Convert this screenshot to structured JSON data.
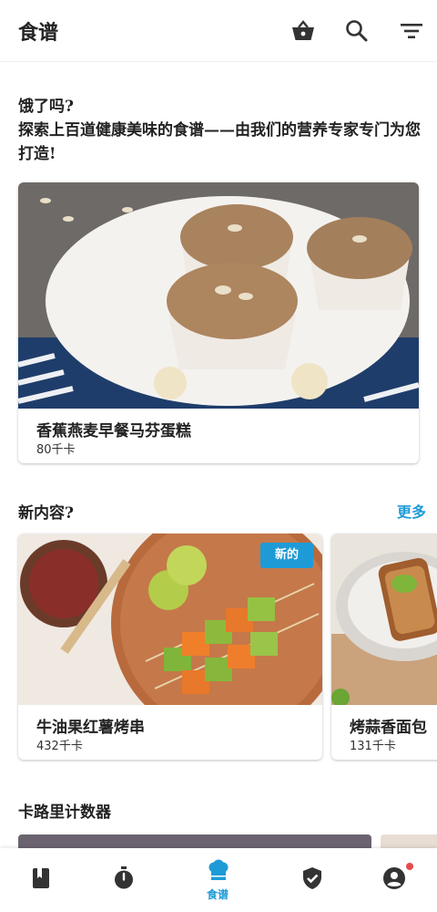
{
  "header": {
    "title": "食谱",
    "icons": [
      "basket-icon",
      "search-icon",
      "filter-icon"
    ]
  },
  "intro": {
    "line1": "饿了吗?",
    "line2": "探索上百道健康美味的食谱——由我们的营养专家专门为您打造!"
  },
  "featured": {
    "name": "香蕉燕麦早餐马芬蛋糕",
    "kcal": "80千卡"
  },
  "new_section": {
    "title": "新内容?",
    "more": "更多",
    "cards": [
      {
        "name": "牛油果红薯烤串",
        "kcal": "432千卡",
        "badge": "新的"
      },
      {
        "name": "烤蒜香面包",
        "kcal": "131千卡"
      }
    ]
  },
  "calorie_section": {
    "title": "卡路里计数器"
  },
  "bottom_nav": {
    "items": [
      {
        "icon": "book-icon",
        "label": ""
      },
      {
        "icon": "timer-icon",
        "label": ""
      },
      {
        "icon": "chef-hat-icon",
        "label": "食谱"
      },
      {
        "icon": "shield-check-icon",
        "label": ""
      },
      {
        "icon": "account-icon",
        "label": ""
      }
    ],
    "active_index": 2
  },
  "colors": {
    "accent": "#1e9bd7",
    "icon": "#333333",
    "notification": "#e64a4a"
  }
}
